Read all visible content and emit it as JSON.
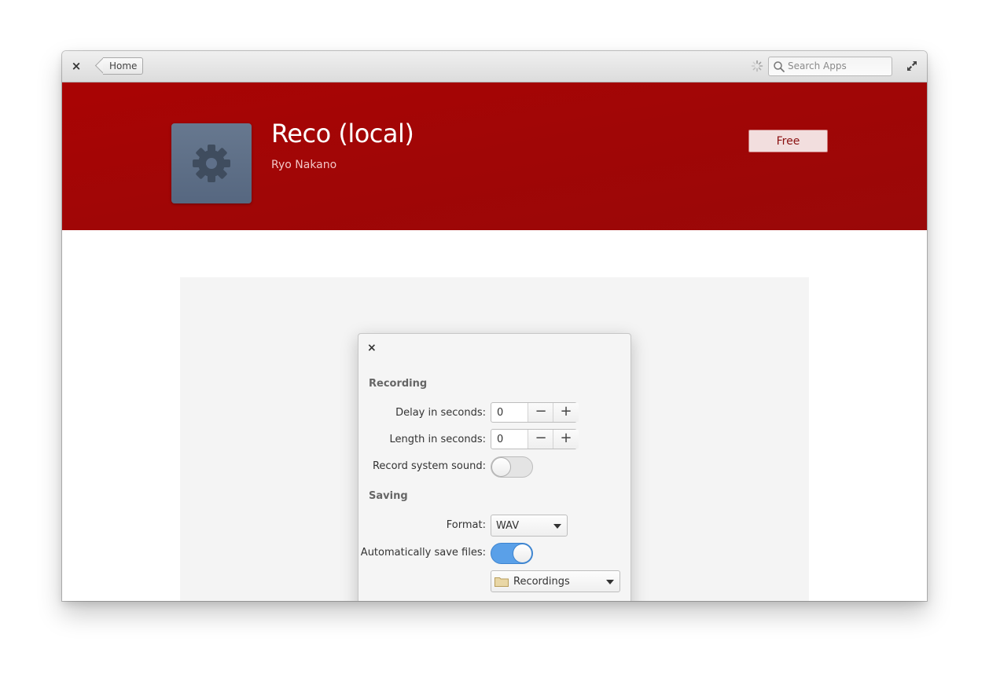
{
  "window": {
    "header": {
      "close_glyph": "×",
      "back_label": "Home",
      "search_placeholder": "Search Apps"
    },
    "banner": {
      "app_title": "Reco (local)",
      "author": "Ryo Nakano",
      "price_label": "Free",
      "color": "#a10505"
    },
    "screenshot": {
      "dialog": {
        "close_glyph": "×",
        "sections": {
          "recording": "Recording",
          "saving": "Saving"
        },
        "delay_label": "Delay in seconds:",
        "delay_value": "0",
        "length_label": "Length in seconds:",
        "length_value": "0",
        "record_sound_label": "Record system sound:",
        "record_sound_on": false,
        "format_label": "Format:",
        "format_value": "WAV",
        "autosave_label": "Automatically save files:",
        "autosave_on": true,
        "folder_value": "Recordings",
        "minus_glyph": "−",
        "plus_glyph": "+"
      }
    }
  }
}
